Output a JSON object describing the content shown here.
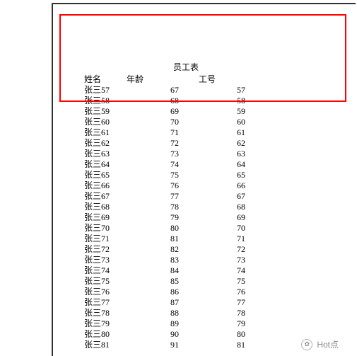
{
  "title": "员工表",
  "columns": {
    "name": "姓名",
    "age": "年龄",
    "emp_no": "工号"
  },
  "rows": [
    {
      "name": "张三57",
      "age": 67,
      "emp_no": 57
    },
    {
      "name": "张三58",
      "age": 68,
      "emp_no": 58
    },
    {
      "name": "张三59",
      "age": 69,
      "emp_no": 59
    },
    {
      "name": "张三60",
      "age": 70,
      "emp_no": 60
    },
    {
      "name": "张三61",
      "age": 71,
      "emp_no": 61
    },
    {
      "name": "张三62",
      "age": 72,
      "emp_no": 62
    },
    {
      "name": "张三63",
      "age": 73,
      "emp_no": 63
    },
    {
      "name": "张三64",
      "age": 74,
      "emp_no": 64
    },
    {
      "name": "张三65",
      "age": 75,
      "emp_no": 65
    },
    {
      "name": "张三66",
      "age": 76,
      "emp_no": 66
    },
    {
      "name": "张三67",
      "age": 77,
      "emp_no": 67
    },
    {
      "name": "张三68",
      "age": 78,
      "emp_no": 68
    },
    {
      "name": "张三69",
      "age": 79,
      "emp_no": 69
    },
    {
      "name": "张三70",
      "age": 80,
      "emp_no": 70
    },
    {
      "name": "张三71",
      "age": 81,
      "emp_no": 71
    },
    {
      "name": "张三72",
      "age": 82,
      "emp_no": 72
    },
    {
      "name": "张三73",
      "age": 83,
      "emp_no": 73
    },
    {
      "name": "张三74",
      "age": 84,
      "emp_no": 74
    },
    {
      "name": "张三75",
      "age": 85,
      "emp_no": 75
    },
    {
      "name": "张三76",
      "age": 86,
      "emp_no": 76
    },
    {
      "name": "张三77",
      "age": 87,
      "emp_no": 77
    },
    {
      "name": "张三78",
      "age": 88,
      "emp_no": 78
    },
    {
      "name": "张三79",
      "age": 89,
      "emp_no": 79
    },
    {
      "name": "张三80",
      "age": 90,
      "emp_no": 80
    },
    {
      "name": "张三81",
      "age": 91,
      "emp_no": 81
    }
  ],
  "watermark": {
    "label": "Hot点",
    "icon": "wechat-icon"
  }
}
